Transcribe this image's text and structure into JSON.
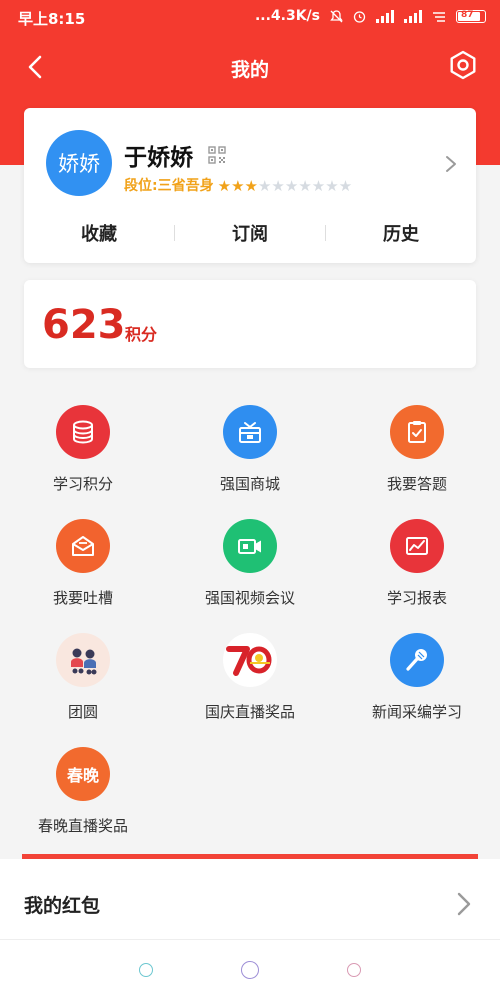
{
  "status_bar": {
    "time": "早上8:15",
    "speed": "...4.3K/s",
    "battery": "87"
  },
  "nav": {
    "title": "我的",
    "back_icon": "chevron-left-icon",
    "settings_icon": "hexagon-settings-icon"
  },
  "profile": {
    "avatar_text": "娇娇",
    "username": "于娇娇",
    "rank_text": "段位:三省吾身",
    "stars_filled": 3,
    "stars_total": 10,
    "tabs": [
      "收藏",
      "订阅",
      "历史"
    ]
  },
  "points": {
    "value": "623",
    "unit": "积分"
  },
  "grid": [
    {
      "label": "学习积分",
      "icon": "database-icon",
      "color": "#e8343a"
    },
    {
      "label": "强国商城",
      "icon": "gift-box-icon",
      "color": "#2f8ef0"
    },
    {
      "label": "我要答题",
      "icon": "clipboard-check-icon",
      "color": "#f26a2e"
    },
    {
      "label": "我要吐槽",
      "icon": "mail-open-icon",
      "color": "#f2632e"
    },
    {
      "label": "强国视频会议",
      "icon": "video-camera-icon",
      "color": "#1fc074"
    },
    {
      "label": "学习报表",
      "icon": "chart-line-icon",
      "color": "#e8343a"
    },
    {
      "label": "团圆",
      "icon": "reunion-illustration-icon",
      "color": "#f9e7df"
    },
    {
      "label": "国庆直播奖品",
      "icon": "70-anniversary-icon",
      "color": "#ffffff"
    },
    {
      "label": "新闻采编学习",
      "icon": "microphone-icon",
      "color": "#2f8ef0"
    },
    {
      "label": "春晚直播奖品",
      "icon": "spring-gala-icon",
      "color": "#f26a2e",
      "icon_text": "春晚"
    }
  ],
  "red_packet": {
    "label": "我的红包"
  },
  "colors": {
    "brand_red": "#f43a2f",
    "star_gold": "#f1a21a",
    "points_red": "#d92b22"
  }
}
